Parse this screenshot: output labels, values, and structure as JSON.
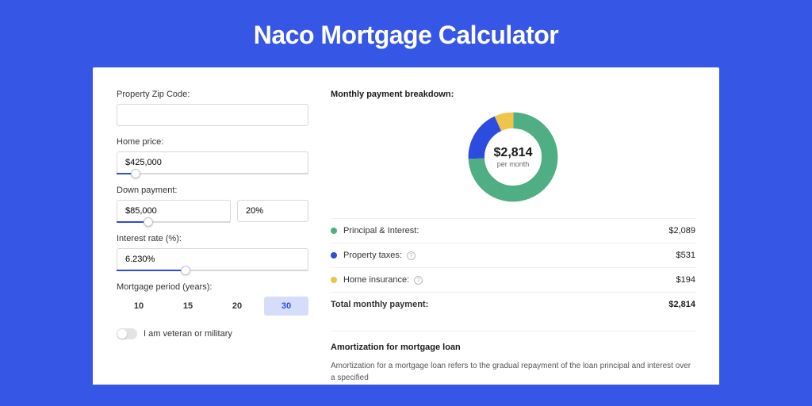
{
  "title": "Naco Mortgage Calculator",
  "form": {
    "zip_label": "Property Zip Code:",
    "zip_value": "",
    "home_price_label": "Home price:",
    "home_price_value": "$425,000",
    "home_price_slider_pct": 10,
    "down_payment_label": "Down payment:",
    "down_payment_value": "$85,000",
    "down_payment_pct_value": "20%",
    "down_payment_slider_pct": 28,
    "interest_label": "Interest rate (%):",
    "interest_value": "6.230%",
    "interest_slider_pct": 36,
    "period_label": "Mortgage period (years):",
    "period_options": [
      "10",
      "15",
      "20",
      "30"
    ],
    "period_selected": "30",
    "veteran_label": "I am veteran or military",
    "veteran_on": false
  },
  "breakdown": {
    "title": "Monthly payment breakdown:",
    "center_amount": "$2,814",
    "center_sub": "per month",
    "items": [
      {
        "label": "Principal & Interest:",
        "value": "$2,089",
        "color": "green",
        "info": false
      },
      {
        "label": "Property taxes:",
        "value": "$531",
        "color": "blue",
        "info": true
      },
      {
        "label": "Home insurance:",
        "value": "$194",
        "color": "yellow",
        "info": true
      }
    ],
    "total_label": "Total monthly payment:",
    "total_value": "$2,814"
  },
  "amortization": {
    "title": "Amortization for mortgage loan",
    "text": "Amortization for a mortgage loan refers to the gradual repayment of the loan principal and interest over a specified"
  },
  "chart_data": {
    "type": "pie",
    "title": "Monthly payment breakdown",
    "series": [
      {
        "name": "Principal & Interest",
        "value": 2089,
        "color": "#4fae83"
      },
      {
        "name": "Property taxes",
        "value": 531,
        "color": "#2b4cdf"
      },
      {
        "name": "Home insurance",
        "value": 194,
        "color": "#eec54a"
      }
    ],
    "total": 2814,
    "donut": true
  }
}
